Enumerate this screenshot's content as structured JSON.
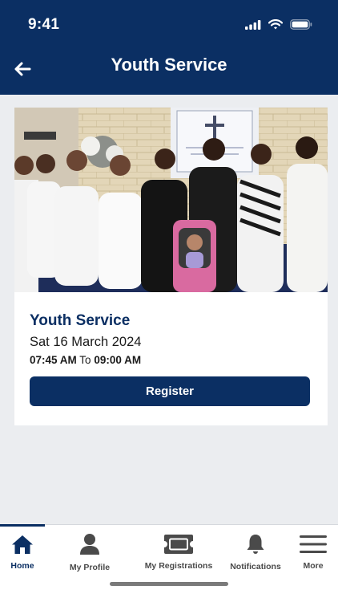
{
  "status_bar": {
    "time": "9:41"
  },
  "header": {
    "title": "Youth Service",
    "back_icon": "arrow-left-icon"
  },
  "event": {
    "title": "Youth Service",
    "date": "Sat 16 March 2024",
    "start_time": "07:45 AM",
    "time_separator": "To",
    "end_time": "09:00 AM",
    "register_label": "Register"
  },
  "tabbar": {
    "items": [
      {
        "label": "Home",
        "icon": "home-icon",
        "active": true
      },
      {
        "label": "My Profile",
        "icon": "person-icon",
        "active": false
      },
      {
        "label": "My Registrations",
        "icon": "ticket-icon",
        "active": false
      },
      {
        "label": "Notifications",
        "icon": "bell-icon",
        "active": false
      },
      {
        "label": "More",
        "icon": "hamburger-menu-icon",
        "active": false
      }
    ]
  },
  "colors": {
    "brand_navy": "#0b2f63",
    "background": "#ebedf0",
    "card": "#ffffff"
  }
}
